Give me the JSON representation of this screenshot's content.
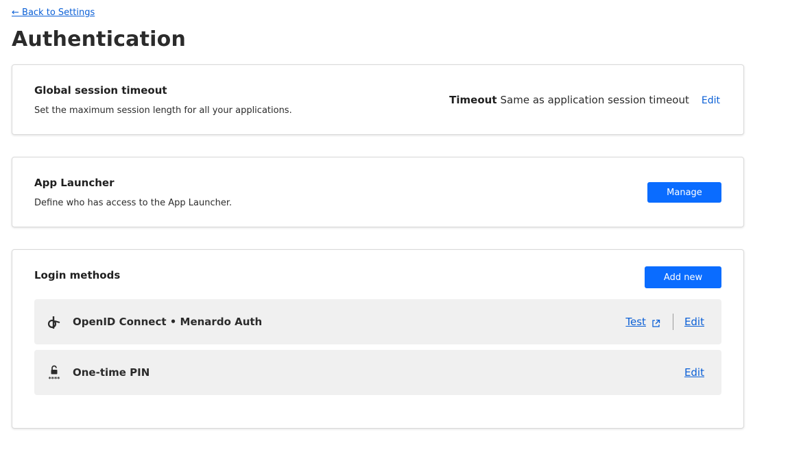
{
  "nav": {
    "back_label": "← Back to Settings"
  },
  "page": {
    "title": "Authentication"
  },
  "session_timeout": {
    "title": "Global session timeout",
    "description": "Set the maximum session length for all your applications.",
    "timeout_key": "Timeout",
    "timeout_value": "Same as application session timeout",
    "edit_label": "Edit"
  },
  "app_launcher": {
    "title": "App Launcher",
    "description": "Define who has access to the App Launcher.",
    "manage_label": "Manage"
  },
  "login_methods": {
    "title": "Login methods",
    "add_label": "Add new",
    "items": [
      {
        "label": "OpenID Connect • Menardo Auth",
        "icon": "openid-icon",
        "test_label": "Test",
        "edit_label": "Edit"
      },
      {
        "label": "One-time PIN",
        "icon": "lock-pin-icon",
        "pin_mask": "****",
        "edit_label": "Edit"
      }
    ]
  },
  "colors": {
    "accent": "#0a6cff",
    "link": "#0a5fd6",
    "row_background": "#f0f0f0",
    "card_border": "#d9d9d9"
  }
}
